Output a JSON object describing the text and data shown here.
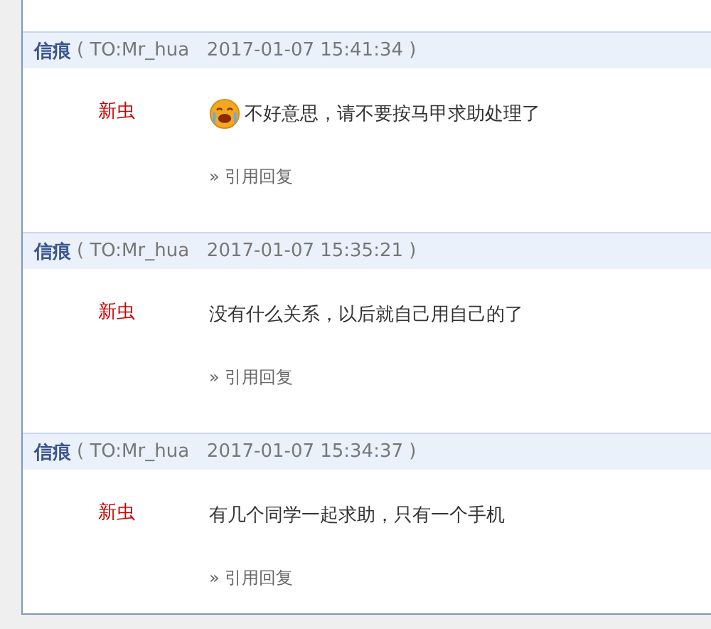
{
  "posts": [
    {
      "sender": "信痕",
      "meta": "( TO:Mr_hua   2017-01-07 15:41:34 )",
      "user": "新虫",
      "emoji": true,
      "text": "不好意思，请不要按马甲求助处理了",
      "quote_link": "» 引用回复"
    },
    {
      "sender": "信痕",
      "meta": "( TO:Mr_hua   2017-01-07 15:35:21 )",
      "user": "新虫",
      "emoji": false,
      "text": "没有什么关系，以后就自己用自己的了",
      "quote_link": "» 引用回复"
    },
    {
      "sender": "信痕",
      "meta": "( TO:Mr_hua   2017-01-07 15:34:37 )",
      "user": "新虫",
      "emoji": false,
      "text": "有几个同学一起求助，只有一个手机",
      "quote_link": "» 引用回复"
    }
  ]
}
